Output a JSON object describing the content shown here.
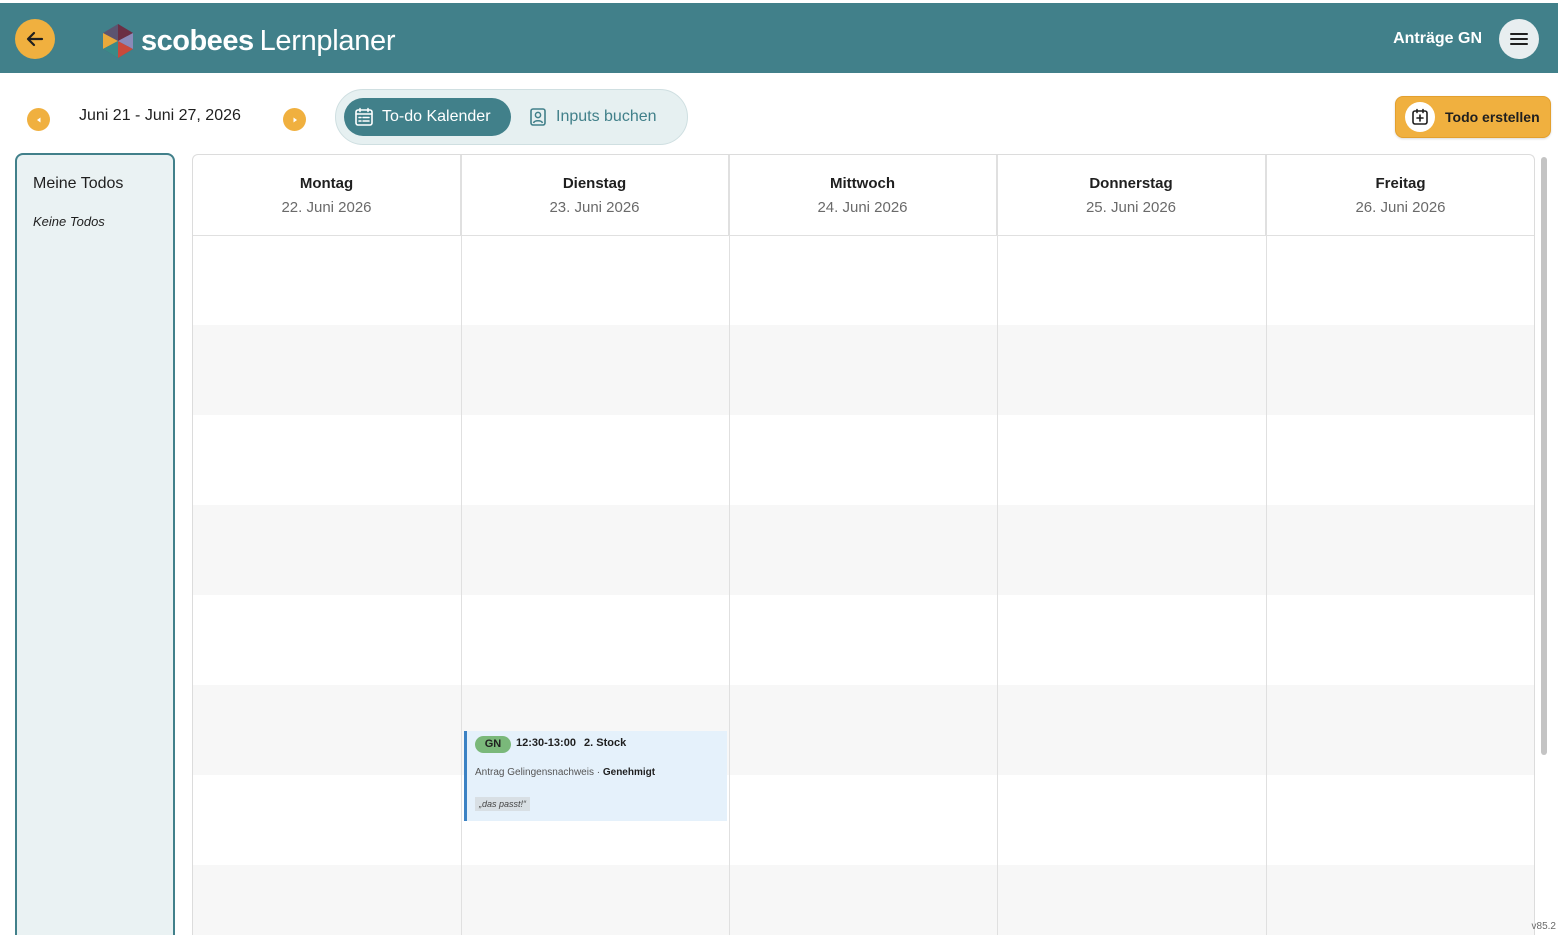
{
  "header": {
    "brand_bold": "scobees",
    "brand_light": "Lernplaner",
    "user_label": "Anträge GN",
    "colors": {
      "bar": "#41808a",
      "accent": "#f0b03f"
    },
    "icons": {
      "back": "arrow-left-icon",
      "menu": "hamburger-menu-icon"
    }
  },
  "toolbar": {
    "date_range": "Juni 21 - Juni 27, 2026",
    "tabs": [
      {
        "label": "To-do Kalender",
        "icon": "calendar-list-icon",
        "active": true
      },
      {
        "label": "Inputs buchen",
        "icon": "person-badge-icon",
        "active": false
      }
    ],
    "create_button": "Todo erstellen"
  },
  "sidebar": {
    "title": "Meine Todos",
    "empty_text": "Keine Todos"
  },
  "calendar": {
    "days": [
      {
        "name": "Montag",
        "date": "22. Juni 2026"
      },
      {
        "name": "Dienstag",
        "date": "23. Juni 2026"
      },
      {
        "name": "Mittwoch",
        "date": "24. Juni 2026"
      },
      {
        "name": "Donnerstag",
        "date": "25. Juni 2026"
      },
      {
        "name": "Freitag",
        "date": "26. Juni 2026"
      }
    ],
    "events": [
      {
        "badge": "GN",
        "time": "12:30-13:00",
        "location": "2. Stock",
        "title": "Antrag Gelingensnachweis · ",
        "status": "Genehmigt",
        "note": "„das passt!“",
        "colors": {
          "background": "#e5f1fb",
          "border": "#3b82c4",
          "badge": "#7ab87a"
        }
      }
    ]
  },
  "version": "v85.2"
}
